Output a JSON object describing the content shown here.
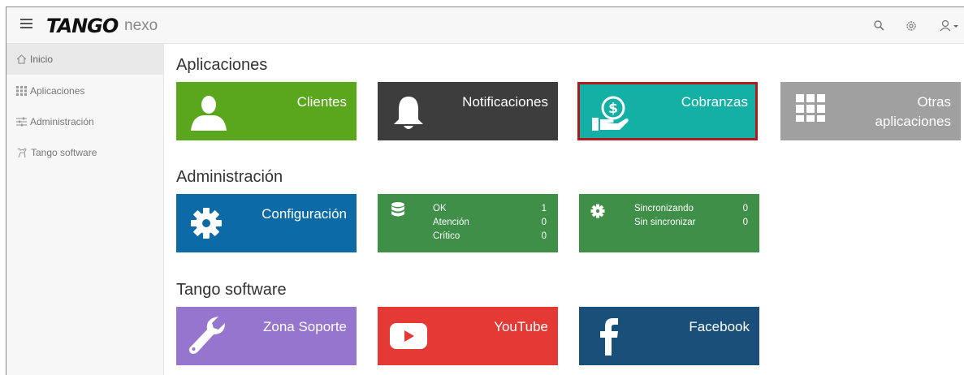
{
  "header": {
    "brand": "TANGO",
    "brand_sub": "nexo"
  },
  "sidebar": {
    "items": [
      {
        "label": "Inicio",
        "icon": "home-icon",
        "active": true
      },
      {
        "label": "Aplicaciones",
        "icon": "grid-icon",
        "active": false
      },
      {
        "label": "Administración",
        "icon": "sliders-icon",
        "active": false
      },
      {
        "label": "Tango software",
        "icon": "cow-icon",
        "active": false
      }
    ]
  },
  "sections": {
    "apps": {
      "title": "Aplicaciones",
      "tiles": [
        {
          "label": "Clientes",
          "color": "#5aa71e",
          "icon": "user-icon"
        },
        {
          "label": "Notificaciones",
          "color": "#3d3d3d",
          "icon": "bell-icon"
        },
        {
          "label": "Cobranzas",
          "color": "#14b0a5",
          "icon": "money-hand-icon",
          "selected": true
        },
        {
          "label_line1": "Otras",
          "label_line2": "aplicaciones",
          "color": "#a0a0a0",
          "icon": "apps-grid-icon"
        }
      ]
    },
    "admin": {
      "title": "Administración",
      "tiles": [
        {
          "label": "Configuración",
          "color": "#0c6aa6",
          "icon": "gear-icon"
        },
        {
          "color": "#3f8f49",
          "icon": "database-icon",
          "rows": [
            {
              "name": "OK",
              "value": "1"
            },
            {
              "name": "Atención",
              "value": "0"
            },
            {
              "name": "Crítico",
              "value": "0"
            }
          ]
        },
        {
          "color": "#3f8f49",
          "icon": "gear-small-icon",
          "rows": [
            {
              "name": "Sincronizando",
              "value": "0"
            },
            {
              "name": "Sin sincronizar",
              "value": "0"
            }
          ]
        }
      ]
    },
    "tango": {
      "title": "Tango software",
      "tiles": [
        {
          "label": "Zona Soporte",
          "color": "#9575cd",
          "icon": "wrench-icon"
        },
        {
          "label": "YouTube",
          "color": "#e53935",
          "icon": "youtube-icon"
        },
        {
          "label": "Facebook",
          "color": "#1a4f7a",
          "icon": "facebook-icon"
        }
      ]
    }
  }
}
